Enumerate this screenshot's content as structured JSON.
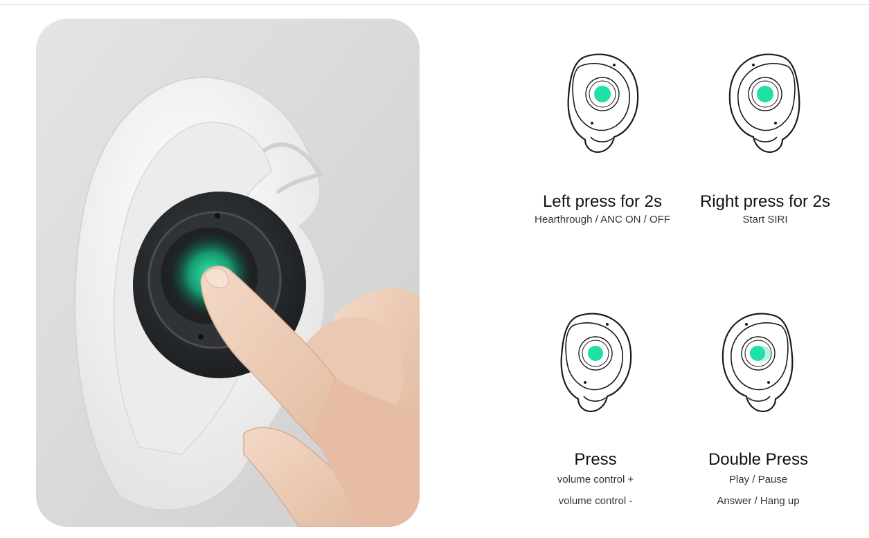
{
  "gestures": [
    {
      "id": "left-press",
      "title": "Left press for 2s",
      "desc_lines": [
        "Hearthrough / ANC ON / OFF"
      ]
    },
    {
      "id": "right-press",
      "title": "Right press for 2s",
      "desc_lines": [
        "Start SIRI"
      ]
    },
    {
      "id": "press",
      "title": "Press",
      "desc_lines": [
        "volume control +",
        "volume control -"
      ]
    },
    {
      "id": "double-press",
      "title": "Double Press",
      "desc_lines": [
        "Play / Pause",
        "Answer / Hang up"
      ]
    }
  ],
  "colors": {
    "accent_green": "#1fe0a6",
    "outline": "#1a1a1a",
    "earbud_dark": "#2b2e31",
    "ear_white": "#f6f6f6",
    "backdrop": "#dcdcdc"
  },
  "icons": {
    "earbud": "earbud-outline-icon",
    "touch_dot": "green-touch-dot-icon"
  }
}
